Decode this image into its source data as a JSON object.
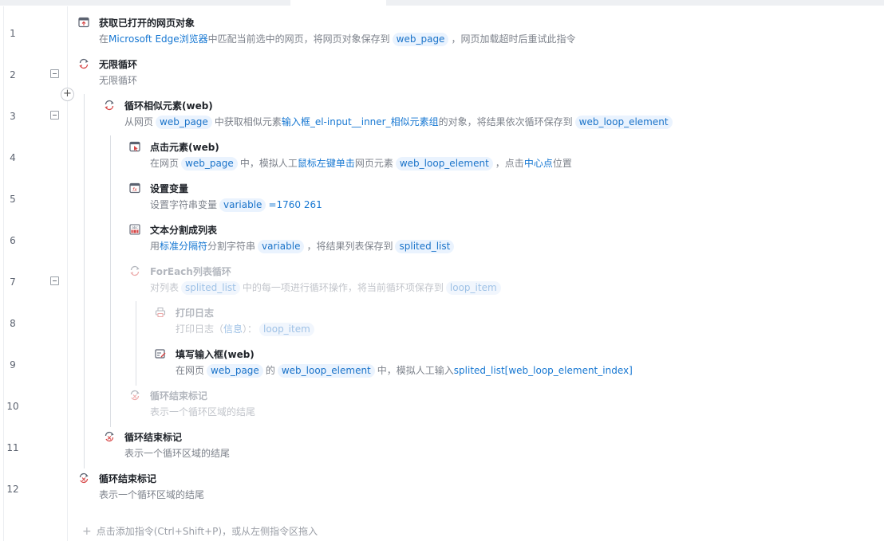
{
  "steps": [
    {
      "line": "1",
      "title": "获取已打开的网页对象",
      "icon": "browser-window-icon",
      "desc": [
        {
          "t": "在"
        },
        {
          "h": "Microsoft Edge浏览器"
        },
        {
          "t": "中匹配当前选中的网页，将网页对象保存到"
        },
        {
          "p": "web_page"
        },
        {
          "t": "，网页加载超时后重试此指令"
        }
      ]
    },
    {
      "line": "2",
      "title": "无限循环",
      "icon": "loop-icon",
      "desc": [
        {
          "t": "无限循环"
        }
      ]
    },
    {
      "line": "3",
      "title": "循环相似元素(web)",
      "icon": "loop-icon",
      "desc": [
        {
          "t": "从网页"
        },
        {
          "p": "web_page"
        },
        {
          "t": "中获取相似元素"
        },
        {
          "h": "输入框_el-input__inner_相似元素组"
        },
        {
          "t": "的对象，将结果依次循环保存到"
        },
        {
          "p": "web_loop_element"
        }
      ]
    },
    {
      "line": "4",
      "title": "点击元素(web)",
      "icon": "click-element-icon",
      "desc": [
        {
          "t": "在网页"
        },
        {
          "p": "web_page"
        },
        {
          "t": "中，模拟人工"
        },
        {
          "h": "鼠标左键单击"
        },
        {
          "t": "网页元素"
        },
        {
          "p": "web_loop_element"
        },
        {
          "t": "，点击"
        },
        {
          "h": "中心点"
        },
        {
          "t": "位置"
        }
      ]
    },
    {
      "line": "5",
      "title": "设置变量",
      "icon": "variable-icon",
      "desc": [
        {
          "t": "设置字符串变量"
        },
        {
          "p": "variable"
        },
        {
          "h": "=1760 261"
        }
      ]
    },
    {
      "line": "6",
      "title": "文本分割成列表",
      "icon": "split-text-icon",
      "desc": [
        {
          "t": "用"
        },
        {
          "h": "标准分隔符"
        },
        {
          "t": "分割字符串"
        },
        {
          "p": "variable"
        },
        {
          "t": "，将结果列表保存到"
        },
        {
          "p": "splited_list"
        }
      ]
    },
    {
      "line": "7",
      "title": "ForEach列表循环",
      "icon": "loop-icon",
      "desc": [
        {
          "t": "对列表"
        },
        {
          "p": "splited_list"
        },
        {
          "t": "中的每一项进行循环操作，将当前循环项保存到"
        },
        {
          "p": "loop_item"
        }
      ]
    },
    {
      "line": "8",
      "title": "打印日志",
      "icon": "print-log-icon",
      "desc": [
        {
          "t": "打印日志（"
        },
        {
          "h": "信息"
        },
        {
          "t": "）："
        },
        {
          "p": "loop_item"
        }
      ]
    },
    {
      "line": "9",
      "title": "填写输入框(web)",
      "icon": "fill-input-icon",
      "desc": [
        {
          "t": "在网页"
        },
        {
          "p": "web_page"
        },
        {
          "t": "的"
        },
        {
          "p": "web_loop_element"
        },
        {
          "t": "中，模拟人工输入"
        },
        {
          "h": "splited_list[web_loop_element_index]"
        }
      ]
    },
    {
      "line": "10",
      "title": "循环结束标记",
      "icon": "loop-end-icon",
      "desc": [
        {
          "t": "表示一个循环区域的结尾"
        }
      ]
    },
    {
      "line": "11",
      "title": "循环结束标记",
      "icon": "loop-end-icon",
      "desc": [
        {
          "t": "表示一个循环区域的结尾"
        }
      ]
    },
    {
      "line": "12",
      "title": "循环结束标记",
      "icon": "loop-end-icon",
      "desc": [
        {
          "t": "表示一个循环区域的结尾"
        }
      ]
    }
  ],
  "add_instruction": "点击添加指令(Ctrl+Shift+P)，或从左侧指令区拖入",
  "colors": {
    "accent": "#1677d2",
    "pill_bg": "#eaf3fe",
    "loop_icon": "#d64545"
  }
}
